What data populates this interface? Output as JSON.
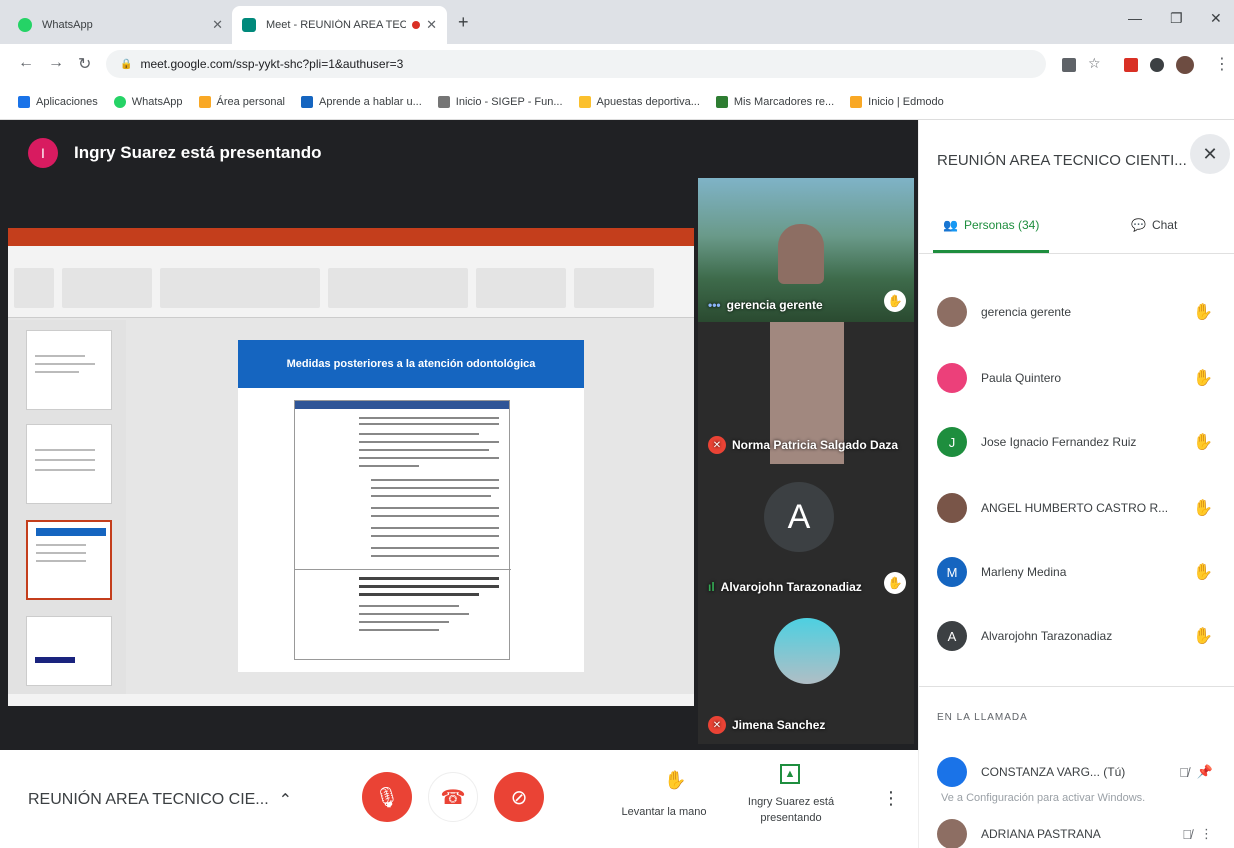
{
  "browser": {
    "tabs": [
      {
        "title": "WhatsApp",
        "active": false
      },
      {
        "title": "Meet - REUNIÓN AREA TEC",
        "active": true
      }
    ],
    "url": "meet.google.com/ssp-yykt-shc?pli=1&authuser=3",
    "bookmarks": [
      "Aplicaciones",
      "WhatsApp",
      "Área personal",
      "Aprende a hablar u...",
      "Inicio - SIGEP - Fun...",
      "Apuestas deportiva...",
      "Mis Marcadores re...",
      "Inicio | Edmodo"
    ]
  },
  "meet": {
    "presenter_banner": "Ingry Suarez está presentando",
    "presenter_initial": "I",
    "slide_title": "Medidas posteriores a la atención odontológica",
    "tiles": [
      {
        "name": "gerencia gerente"
      },
      {
        "name": "Norma Patricia Salgado Daza"
      },
      {
        "name": "Alvarojohn Tarazonadiaz",
        "initial": "A"
      },
      {
        "name": "Jimena Sanchez"
      }
    ]
  },
  "bottombar": {
    "meeting_name": "REUNIÓN AREA TECNICO CIE...",
    "raise_hand": "Levantar la mano",
    "presenting": "Ingry Suarez está presentando"
  },
  "sidepanel": {
    "title": "REUNIÓN AREA TECNICO CIENTI...",
    "tab_people": "Personas (34)",
    "tab_chat": "Chat",
    "people": [
      {
        "name": "gerencia gerente",
        "avatar_color": "#8d6e63",
        "initial": ""
      },
      {
        "name": "Paula Quintero",
        "avatar_color": "#ec407a",
        "initial": ""
      },
      {
        "name": "Jose Ignacio Fernandez Ruiz",
        "avatar_color": "#1e8e3e",
        "initial": "J"
      },
      {
        "name": "ANGEL HUMBERTO CASTRO R...",
        "avatar_color": "#795548",
        "initial": ""
      },
      {
        "name": "Marleny Medina",
        "avatar_color": "#1565c0",
        "initial": "M"
      },
      {
        "name": "Alvarojohn Tarazonadiaz",
        "avatar_color": "#3c4043",
        "initial": "A"
      }
    ],
    "in_call_label": "EN LA LLAMADA",
    "in_call": [
      {
        "name": "CONSTANZA VARG... (Tú)",
        "avatar_color": "#1a73e8",
        "initial": ""
      },
      {
        "name": "ADRIANA PASTRANA",
        "avatar_color": "#8d6e63",
        "initial": ""
      }
    ],
    "windows_watermark": "Ve a Configuración para activar Windows."
  }
}
